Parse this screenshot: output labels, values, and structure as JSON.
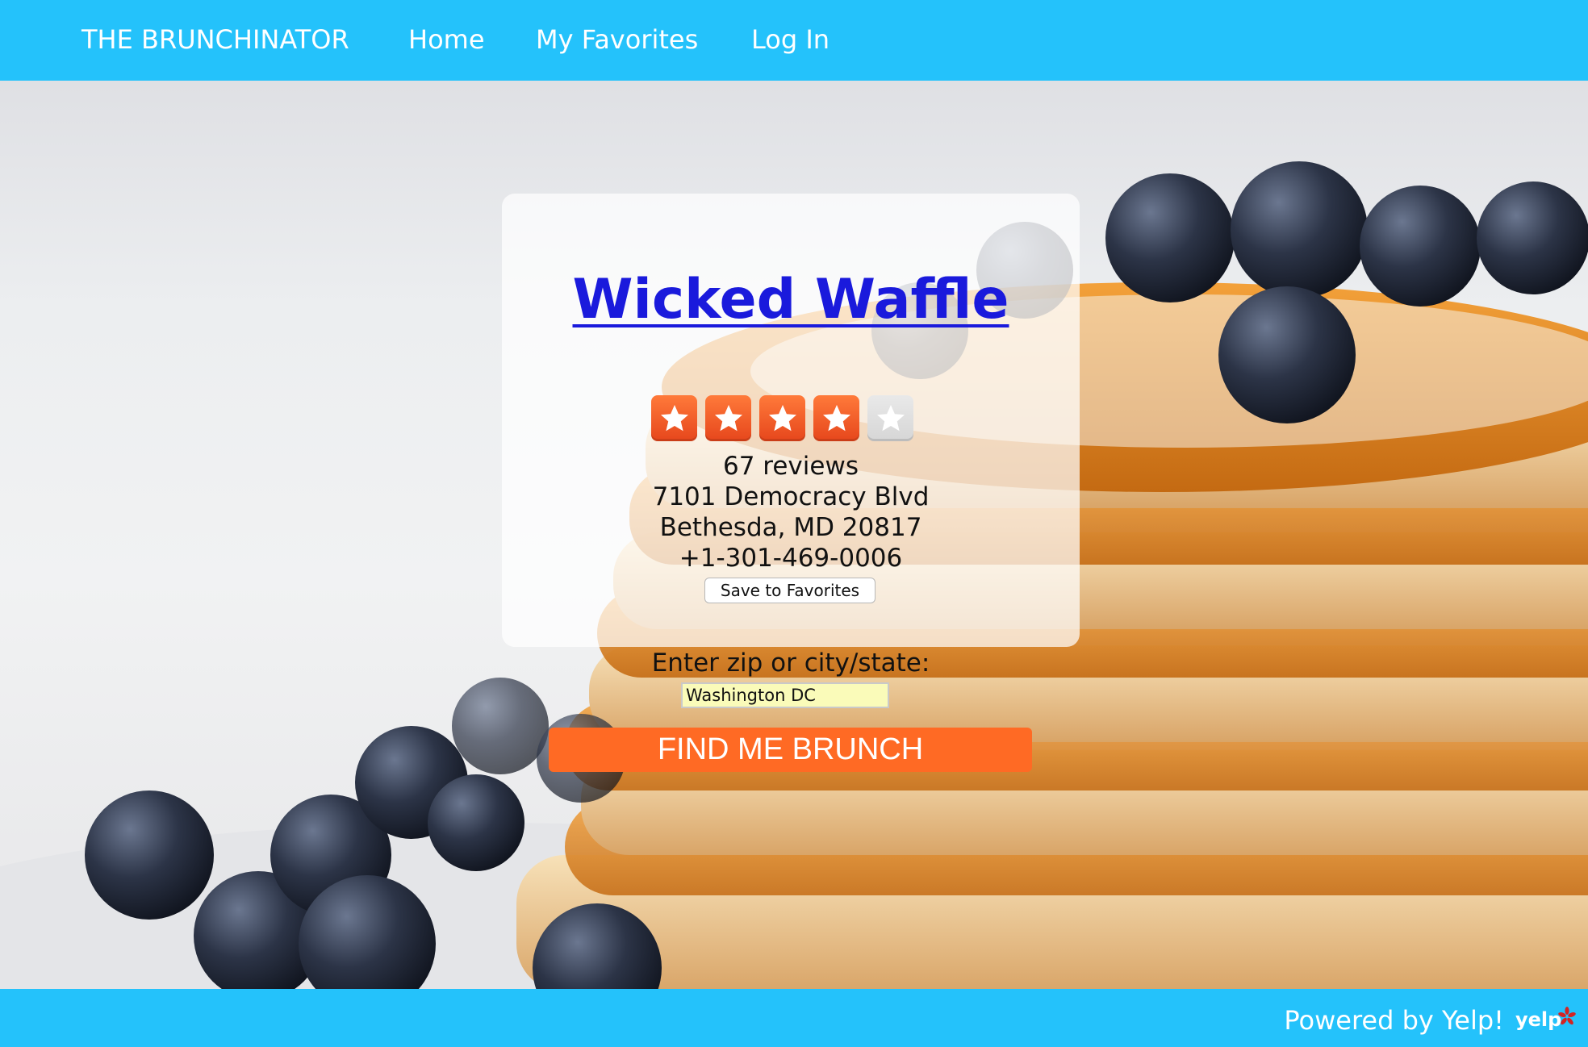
{
  "nav": {
    "brand": "THE BRUNCHINATOR",
    "home": "Home",
    "favorites": "My Favorites",
    "login": "Log In"
  },
  "restaurant": {
    "name": "Wicked Waffle",
    "rating": 4,
    "rating_max": 5,
    "reviews": "67 reviews",
    "street": "7101 Democracy Blvd",
    "city_line": "Bethesda, MD 20817",
    "phone": "+1-301-469-0006",
    "save_label": "Save to Favorites"
  },
  "search": {
    "label": "Enter zip or city/state:",
    "value": "Washington DC",
    "button_label": "FIND ME BRUNCH"
  },
  "footer": {
    "text": "Powered by Yelp!",
    "logo_text": "yelp"
  },
  "colors": {
    "nav_bg": "#24c2fb",
    "accent": "#ff6a24",
    "link": "#1a1adc",
    "input_bg": "#fafbb9"
  }
}
